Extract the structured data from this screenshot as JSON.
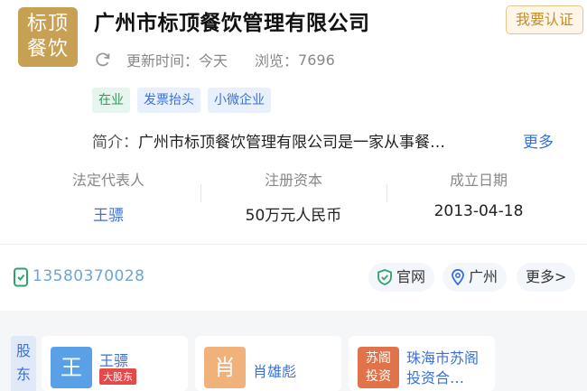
{
  "company": {
    "logo_line1": "标顶",
    "logo_line2": "餐饮",
    "name": "广州市标顶餐饮管理有限公司",
    "claim_label": "我要认证"
  },
  "meta": {
    "updated_label": "更新时间：",
    "updated_value": "今天",
    "views_label": "浏览：",
    "views_value": "7696"
  },
  "tags": [
    "在业",
    "发票抬头",
    "小微企业"
  ],
  "intro": {
    "label": "简介：",
    "text": "广州市标顶餐饮管理有限公司是一家从事餐…",
    "more": "更多"
  },
  "stats": [
    {
      "label": "法定代表人",
      "value": "王骠"
    },
    {
      "label": "注册资本",
      "value": "50万元人民币"
    },
    {
      "label": "成立日期",
      "value": "2013-04-18"
    }
  ],
  "contact": {
    "phone": "13580370028",
    "website": "官网",
    "location": "广州",
    "more": "更多>"
  },
  "shareholders": {
    "tab_label": "股东",
    "items": [
      {
        "avatar": "王",
        "name": "王骠",
        "badge": "大股东",
        "color": "#5aa0e6"
      },
      {
        "avatar": "肖",
        "name": "肖雄彪",
        "color": "#f0b27a"
      },
      {
        "avatar": "苏阁投资",
        "name": "珠海市苏阁投资合…",
        "color": "#e0734a"
      }
    ]
  }
}
